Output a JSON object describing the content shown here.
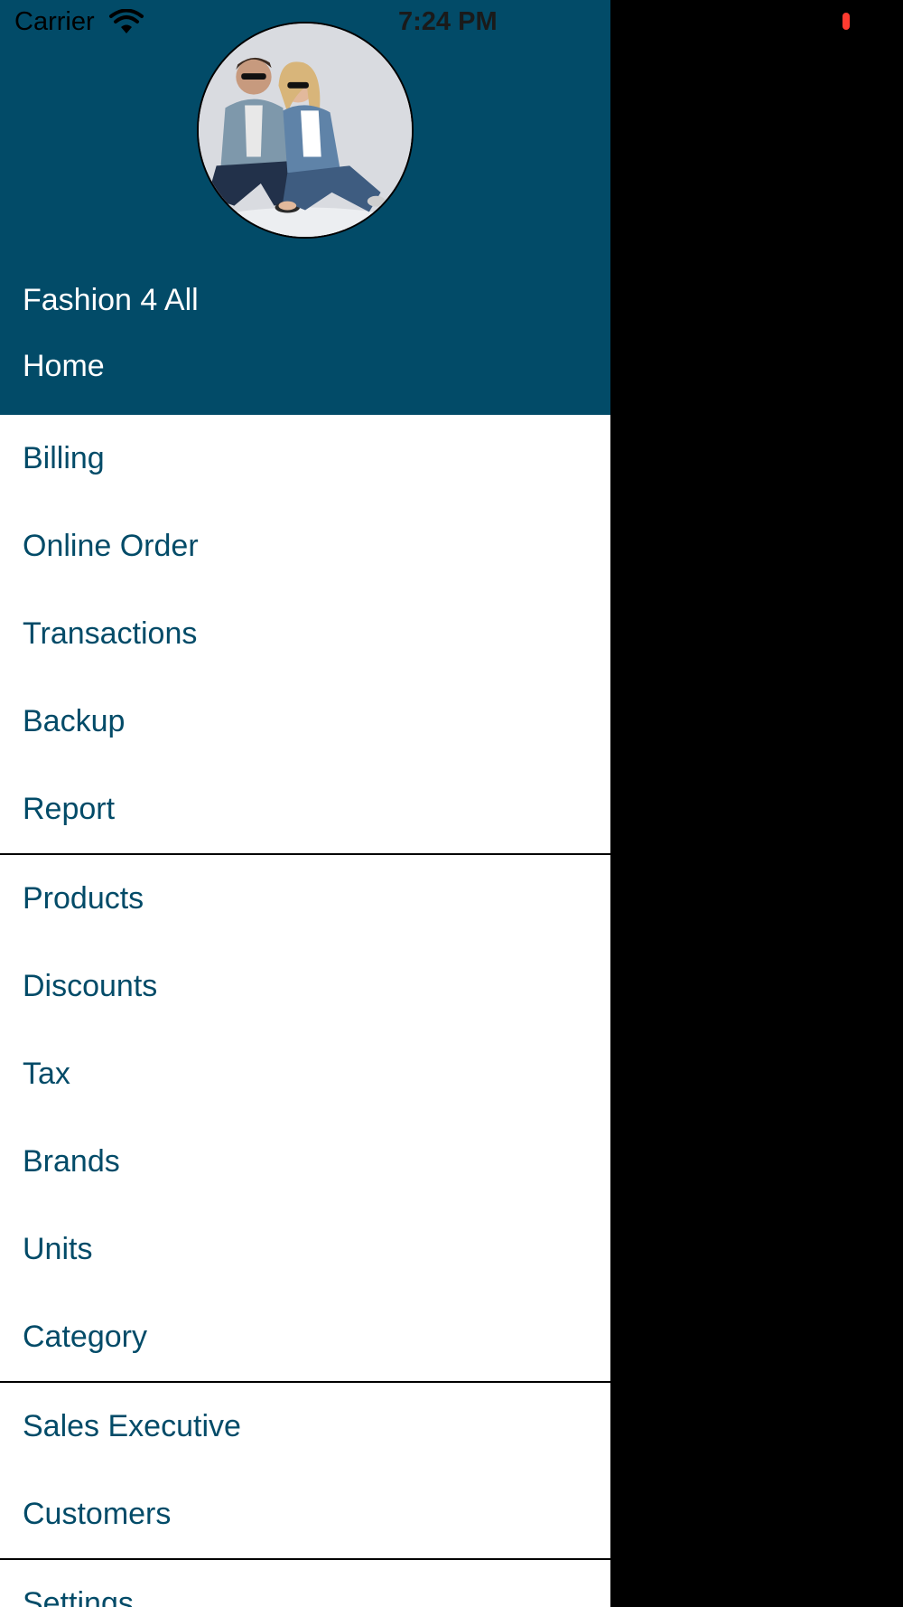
{
  "status_bar": {
    "carrier": "Carrier",
    "time": "7:24 PM",
    "icons": [
      "wifi-icon",
      "battery-icon"
    ],
    "battery_color": "#ff3b30"
  },
  "drawer": {
    "header_color": "#024b68",
    "text_color": "#024b68",
    "store_name": "Fashion 4 All",
    "home_label": "Home",
    "groups": [
      {
        "items": [
          "Billing",
          "Online Order",
          "Transactions",
          "Backup",
          "Report"
        ]
      },
      {
        "items": [
          "Products",
          "Discounts",
          "Tax",
          "Brands",
          "Units",
          "Category"
        ]
      },
      {
        "items": [
          "Sales Executive",
          "Customers"
        ]
      },
      {
        "items": [
          "Settings"
        ]
      }
    ]
  }
}
